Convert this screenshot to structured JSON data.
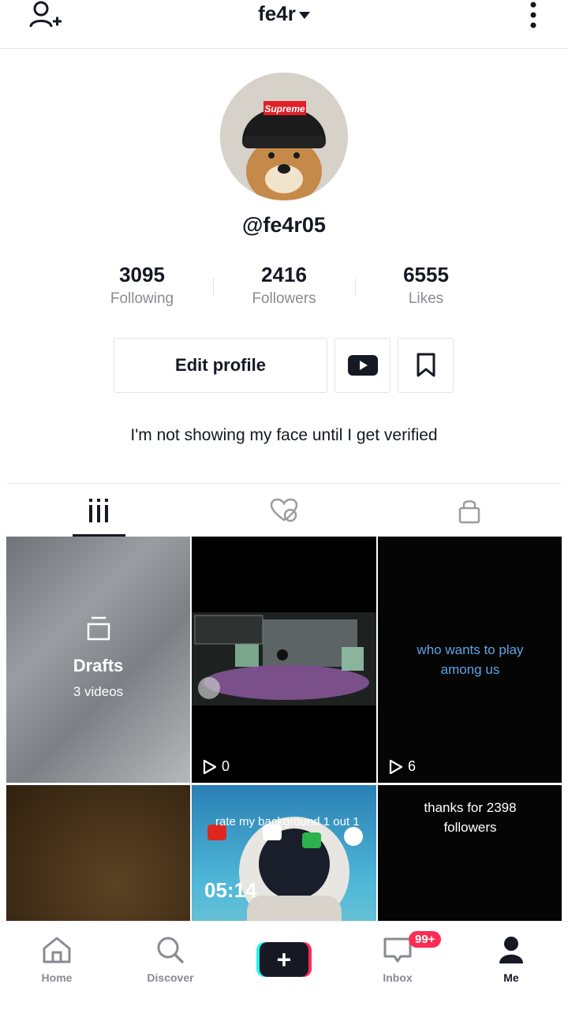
{
  "header": {
    "username": "fe4r",
    "add_user_icon": "add-user-icon",
    "more_icon": "more-vertical-icon"
  },
  "profile": {
    "handle": "@fe4r05",
    "avatar_text": "Supreme",
    "bio": "I'm not showing my face until I get verified"
  },
  "stats": [
    {
      "value": "3095",
      "label": "Following"
    },
    {
      "value": "2416",
      "label": "Followers"
    },
    {
      "value": "6555",
      "label": "Likes"
    }
  ],
  "actions": {
    "edit_profile": "Edit profile"
  },
  "tabs": [
    "videos-grid-icon",
    "liked-hidden-icon",
    "lock-icon"
  ],
  "grid": {
    "drafts": {
      "title": "Drafts",
      "count": "3 videos"
    },
    "cells": [
      {
        "views": "0"
      },
      {
        "views": "6",
        "text_line1": "who wants to play",
        "text_line2": "among us"
      },
      {
        "text_line1": "thanks for 2398",
        "text_line2": "followers"
      },
      {
        "clock": "05:14",
        "overtext": "rate my background 1 out 1"
      }
    ]
  },
  "bottom_nav": {
    "home": "Home",
    "discover": "Discover",
    "inbox": "Inbox",
    "inbox_badge": "99+",
    "me": "Me"
  },
  "colors": {
    "accent": "#fe2c55",
    "cyan": "#25f4ee",
    "text": "#161823",
    "muted": "#8a8b91"
  }
}
